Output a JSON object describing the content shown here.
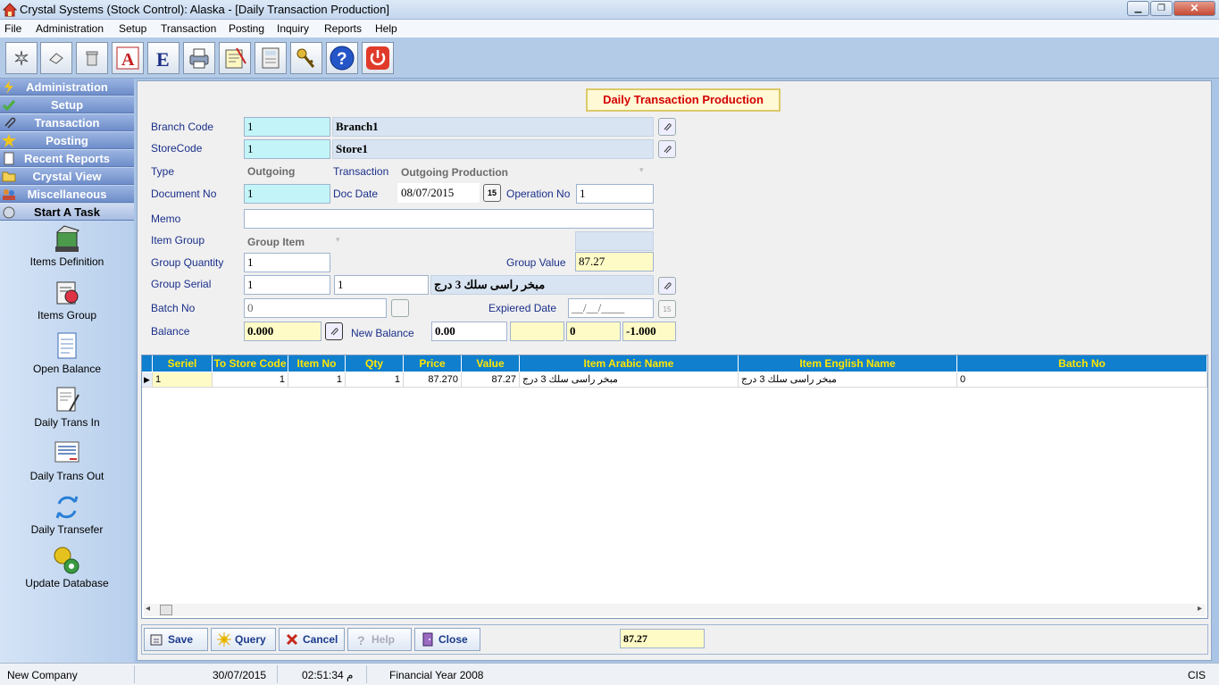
{
  "window": {
    "title": "Crystal Systems (Stock Control):  Alaska - [Daily Transaction Production]"
  },
  "menu": [
    "File",
    "Administration",
    "Setup",
    "Transaction",
    "Posting",
    "Inquiry",
    "Reports",
    "Help"
  ],
  "toolbar_icons": [
    "new-icon",
    "erase-icon",
    "delete-icon",
    "arabic-a-icon",
    "english-e-icon",
    "printer-icon",
    "notes-icon",
    "calculator-icon",
    "keys-icon",
    "help-icon",
    "power-icon"
  ],
  "sidebar": {
    "groups": [
      "Administration",
      "Setup",
      "Transaction",
      "Posting",
      "Recent Reports",
      "Crystal View",
      "Miscellaneous",
      "Start A Task"
    ],
    "tasks": [
      "Items Definition",
      "Items Group",
      "Open Balance",
      "Daily Trans In",
      "Daily Trans Out",
      "Daily Transefer",
      "Update Database"
    ]
  },
  "form": {
    "title": "Daily Transaction Production",
    "branch_code_label": "Branch Code",
    "branch_code": "1",
    "branch_name": "Branch1",
    "store_code_label": "StoreCode",
    "store_code": "1",
    "store_name": "Store1",
    "type_label": "Type",
    "type_value": "Outgoing",
    "transaction_label": "Transaction",
    "transaction_value": "Outgoing Production",
    "document_no_label": "Document No",
    "document_no": "1",
    "doc_date_label": "Doc Date",
    "doc_date": "08/07/2015",
    "calendar_label": "15",
    "operation_no_label": "Operation No",
    "operation_no": "1",
    "memo_label": "Memo",
    "memo": "",
    "item_group_label": "Item Group",
    "item_group": "Group Item",
    "group_quantity_label": "Group Quantity",
    "group_quantity": "1",
    "group_value_label": "Group Value",
    "group_value": "87.27",
    "group_serial_label": "Group Serial",
    "group_serial_1": "1",
    "group_serial_2": "1",
    "group_serial_name": "مبخر راسى سلك 3 درج",
    "batch_no_label": "Batch No",
    "batch_no": "0",
    "expired_date_label": "Expiered Date",
    "expired_date": "__/__/____",
    "expired_cal": "15",
    "balance_label": "Balance",
    "balance": "0.000",
    "new_balance_label": "New Balance",
    "new_balance": "0.00",
    "nb_extra_1": "",
    "nb_extra_2": "0",
    "nb_extra_3": "-1.000"
  },
  "grid": {
    "columns": [
      "Seriel",
      "To Store Code",
      "Item No",
      "Qty",
      "Price",
      "Value",
      "Item Arabic Name",
      "Item English Name",
      "Batch No"
    ],
    "rows": [
      {
        "seriel": "1",
        "to_store": "1",
        "item_no": "1",
        "qty": "1",
        "price": "87.270",
        "value": "87.27",
        "arabic": "مبخر راسى سلك 3 درج",
        "english": "مبخر راسى سلك 3 درج",
        "batch": "0"
      }
    ]
  },
  "buttons": {
    "save": "Save",
    "query": "Query",
    "cancel": "Cancel",
    "help": "Help",
    "close": "Close",
    "total": "87.27"
  },
  "status": {
    "company": "New Company",
    "date": "30/07/2015",
    "time": "02:51:34 م",
    "fiscal": "Financial Year 2008",
    "code": "CIS"
  },
  "colors": {
    "grid_header": "#0f7fce",
    "grid_header_text": "#ffe600",
    "form_title": "#d40000",
    "cyan_field": "#c3f5f8",
    "yellow_field": "#fffbc7"
  }
}
